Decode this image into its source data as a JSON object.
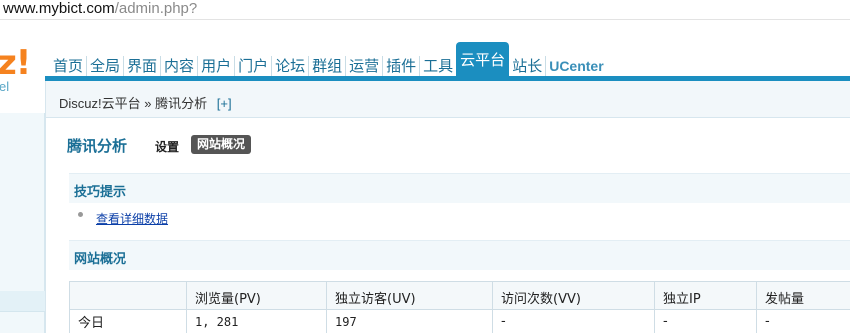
{
  "browser": {
    "url_host": "www.mybict.com",
    "url_path": "/admin.php?"
  },
  "logo": {
    "mark": "z!",
    "sub": "el"
  },
  "nav": {
    "items": [
      "首页",
      "全局",
      "界面",
      "内容",
      "用户",
      "门户",
      "论坛",
      "群组",
      "运营",
      "插件",
      "工具",
      "云平台",
      "站长",
      "UCenter"
    ],
    "active": "云平台"
  },
  "breadcrumb": {
    "root": "Discuz!云平台",
    "sep": "»",
    "current": "腾讯分析",
    "add": "[+]"
  },
  "page": {
    "title": "腾讯分析",
    "tabs": {
      "settings": "设置",
      "overview": "网站概况"
    }
  },
  "tips": {
    "heading": "技巧提示",
    "link": "查看详细数据"
  },
  "overview": {
    "heading": "网站概况",
    "columns": [
      "",
      "浏览量(PV)",
      "独立访客(UV)",
      "访问次数(VV)",
      "独立IP",
      "发帖量"
    ],
    "rows": [
      {
        "label": "今日",
        "pv": "1, 281",
        "uv": "197",
        "vv": "-",
        "ip": "-",
        "posts": "-"
      }
    ]
  },
  "colors": {
    "accent": "#1b8ec0",
    "link": "#1b6f96",
    "logo": "#f5821f"
  }
}
